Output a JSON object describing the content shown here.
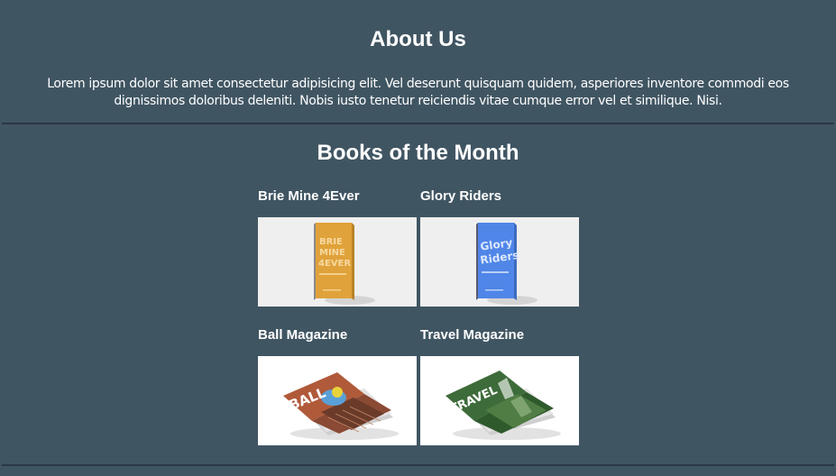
{
  "about": {
    "title": "About Us",
    "text": "Lorem ipsum dolor sit amet consectetur adipisicing elit. Vel deserunt quisquam quidem, asperiores inventore commodi eos dignissimos doloribus deleniti. Nobis iusto tenetur reiciendis vitae cumque error vel et similique. Nisi."
  },
  "books": {
    "title": "Books of the Month",
    "items": [
      {
        "name": "Brie Mine 4Ever",
        "cover_text": "BRIE MINE 4EVER",
        "cover_color": "#e0a23a"
      },
      {
        "name": "Glory Riders",
        "cover_text": "Glory Riders",
        "cover_color": "#4f86e8"
      },
      {
        "name": "Ball Magazine",
        "cover_text": "BALL",
        "cover_color": "#b05a3a"
      },
      {
        "name": "Travel Magazine",
        "cover_text": "TRAVEL",
        "cover_color": "#3d6b3a"
      }
    ]
  },
  "colors": {
    "background": "#405562",
    "divider": "#2c3845",
    "cover_bg_light": "#efefef",
    "cover_bg_white": "#ffffff"
  }
}
